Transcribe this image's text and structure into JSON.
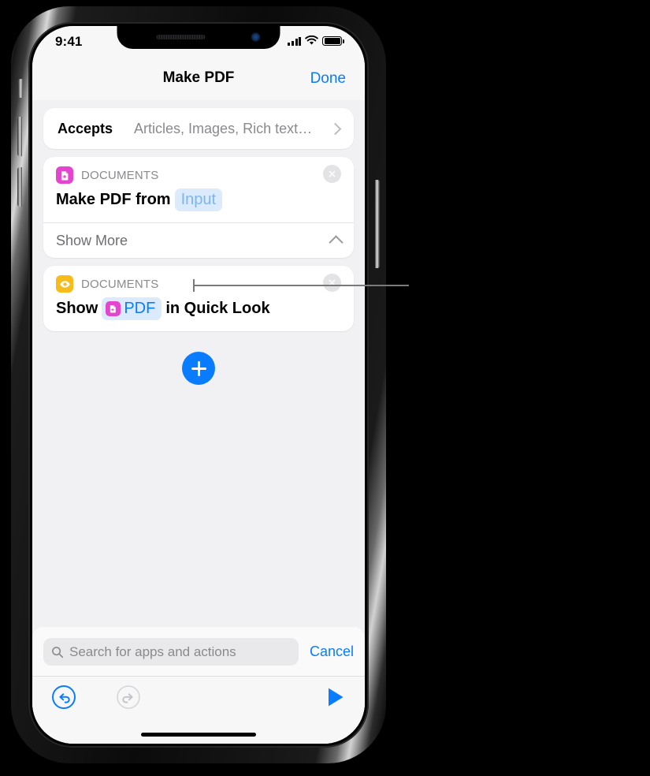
{
  "status_bar": {
    "time": "9:41",
    "signal_icon": "cellular-signal-icon",
    "wifi_icon": "wifi-icon",
    "battery_icon": "battery-full-icon"
  },
  "nav": {
    "title": "Make PDF",
    "done_label": "Done"
  },
  "accepts": {
    "label": "Accepts",
    "value": "Articles, Images, Rich text…",
    "chevron_icon": "chevron-right-icon"
  },
  "actions": [
    {
      "category": "DOCUMENTS",
      "icon_name": "document-pdf-icon",
      "icon_color": "#E544CE",
      "text_before": "Make PDF from",
      "token": "Input",
      "text_after": "",
      "close_icon": "close-circle-icon",
      "show_more_label": "Show More",
      "show_more_chevron": "chevron-up-icon"
    },
    {
      "category": "DOCUMENTS",
      "icon_name": "eye-icon",
      "icon_color": "#F5BC1B",
      "text_before": "Show",
      "token": "PDF",
      "token_icon_name": "document-pdf-icon",
      "text_after": "in Quick Look",
      "close_icon": "close-circle-icon"
    }
  ],
  "add_action": {
    "icon_name": "plus-icon",
    "color": "#0A7CFF"
  },
  "search": {
    "placeholder": "Search for apps and actions",
    "search_icon": "search-icon",
    "cancel_label": "Cancel"
  },
  "toolbar": {
    "undo_icon": "undo-icon",
    "redo_icon": "redo-icon",
    "run_icon": "play-icon",
    "undo_color": "#0A7CFF",
    "redo_color": "#C9C9CE",
    "run_color": "#0A7CFF"
  },
  "colors": {
    "accent": "#0A7CFF",
    "screen_background": "#F1F1F4",
    "card_background": "#FFFFFF",
    "token_background": "#DCEBFB"
  }
}
